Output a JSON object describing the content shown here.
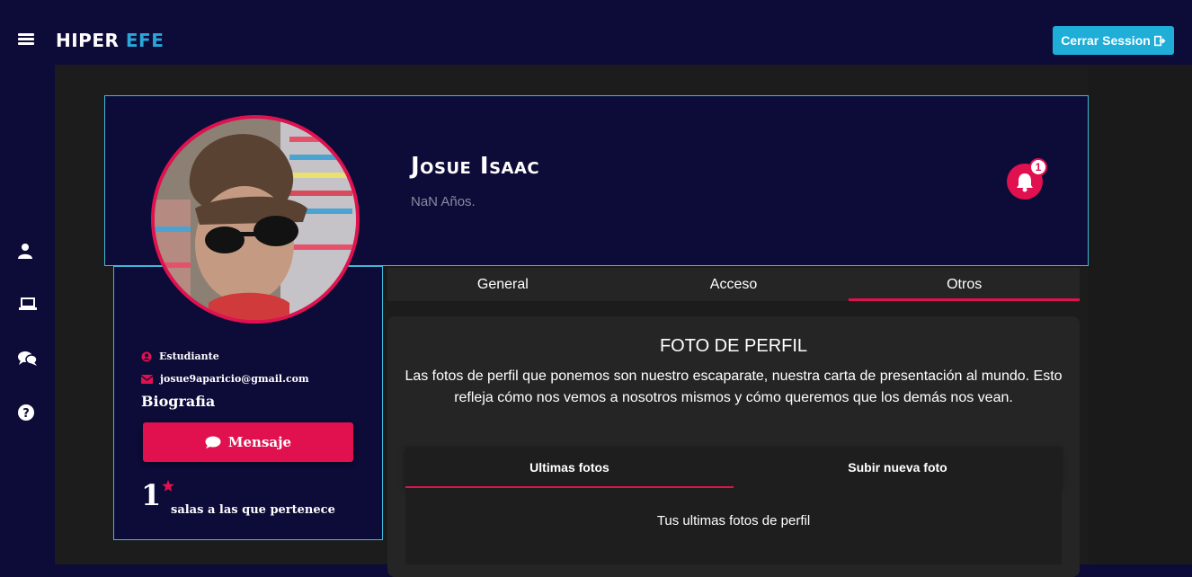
{
  "app": {
    "logo_part1": "HIPER",
    "logo_part2": "EFE",
    "logout_label": "Cerrar Session"
  },
  "sidebar": {
    "items": [
      {
        "icon": "user-icon"
      },
      {
        "icon": "laptop-icon"
      },
      {
        "icon": "chat-icon"
      },
      {
        "icon": "help-icon"
      }
    ]
  },
  "profile": {
    "name": "Josue Isaac",
    "age": "NaN Años.",
    "notifications_count": "1",
    "role": "Estudiante",
    "email": "josue9aparicio@gmail.com",
    "bio_title": "Biografia",
    "message_label": "Mensaje",
    "rooms_count": "1",
    "rooms_label": "salas a las que pertenece"
  },
  "tabs": {
    "items": [
      "General",
      "Acceso",
      "Otros"
    ],
    "active": "Otros"
  },
  "photo_section": {
    "title": "FOTO DE PERFIL",
    "description": "Las fotos de perfil que ponemos son nuestro escaparate, nuestra carta de presentación al mundo. Esto refleja cómo nos vemos a nosotros mismos y cómo queremos que los demás nos vean.",
    "subtabs": [
      "Ultimas fotos",
      "Subir nueva foto"
    ],
    "active_subtab": "Ultimas fotos",
    "panel_text": "Tus ultimas fotos de perfil"
  },
  "colors": {
    "navy": "#0d0b38",
    "accent": "#e0114e",
    "cyan": "#1eaed8",
    "dark_panel": "#252525"
  }
}
